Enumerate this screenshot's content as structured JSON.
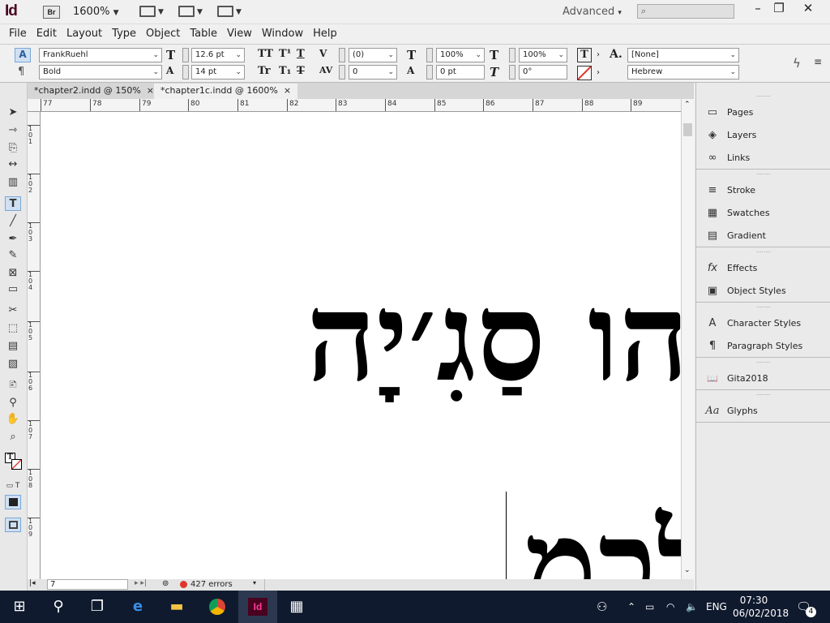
{
  "app": {
    "logo": "Id",
    "bridge": "Br",
    "zoom": "1600%",
    "workspace": "Advanced"
  },
  "window": {
    "minimize": "–",
    "restore": "❐",
    "close": "✕"
  },
  "menu": [
    "File",
    "Edit",
    "Layout",
    "Type",
    "Object",
    "Table",
    "View",
    "Window",
    "Help"
  ],
  "control": {
    "font_family": "FrankRuehl",
    "font_style": "Bold",
    "font_size": "12.6 pt",
    "leading": "14 pt",
    "kerning": "(0)",
    "tracking": "0",
    "vscale": "100%",
    "baseline": "0 pt",
    "hscale": "100%",
    "skew": "0°",
    "char_style": "[None]",
    "language": "Hebrew"
  },
  "tabs": [
    {
      "label": "*chapter2.indd @ 150%",
      "close": "×"
    },
    {
      "label": "*chapter1c.indd @ 1600%",
      "close": "×"
    }
  ],
  "ruler": {
    "h": [
      "77",
      "78",
      "79",
      "80",
      "81",
      "82",
      "83",
      "84",
      "85",
      "86",
      "87",
      "88",
      "89"
    ],
    "v": [
      "1\n0\n1",
      "1\n0\n2",
      "1\n0\n3",
      "1\n0\n4",
      "1\n0\n5",
      "1\n0\n6",
      "1\n0\n7",
      "1\n0\n8",
      "1\n0\n9"
    ]
  },
  "canvas": {
    "line1": "הו סַגִ׳יָה",
    "line2": "לְכַמ"
  },
  "status": {
    "page": "7",
    "errors": "427 errors"
  },
  "panels": [
    [
      {
        "label": "Pages",
        "icon": "pages-icon",
        "glyph": "▭"
      },
      {
        "label": "Layers",
        "icon": "layers-icon",
        "glyph": "◈"
      },
      {
        "label": "Links",
        "icon": "links-icon",
        "glyph": "∞"
      }
    ],
    [
      {
        "label": "Stroke",
        "icon": "stroke-icon",
        "glyph": "≡"
      },
      {
        "label": "Swatches",
        "icon": "swatches-icon",
        "glyph": "▦"
      },
      {
        "label": "Gradient",
        "icon": "gradient-icon",
        "glyph": "▤"
      }
    ],
    [
      {
        "label": "Effects",
        "icon": "effects-icon",
        "glyph": "fx"
      },
      {
        "label": "Object Styles",
        "icon": "object-styles-icon",
        "glyph": "▣"
      }
    ],
    [
      {
        "label": "Character Styles",
        "icon": "character-styles-icon",
        "glyph": "A"
      },
      {
        "label": "Paragraph Styles",
        "icon": "paragraph-styles-icon",
        "glyph": "¶"
      }
    ],
    [
      {
        "label": "Gita2018",
        "icon": "library-icon",
        "glyph": "📖"
      }
    ],
    [
      {
        "label": "Glyphs",
        "icon": "glyphs-icon",
        "glyph": "Aa"
      }
    ]
  ],
  "taskbar": {
    "lang": "ENG",
    "time": "07:30",
    "date": "06/02/2018",
    "notifications": "4"
  },
  "colors": {
    "indesign": "#49021f",
    "taskbar": "#101a2e",
    "error": "#e0352b"
  }
}
